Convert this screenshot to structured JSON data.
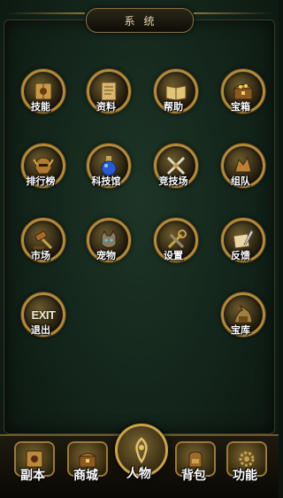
{
  "header": {
    "title": "系统"
  },
  "menu": [
    {
      "label": "技能",
      "icon": "spellbook-icon"
    },
    {
      "label": "资料",
      "icon": "scroll-icon"
    },
    {
      "label": "帮助",
      "icon": "open-book-icon"
    },
    {
      "label": "宝箱",
      "icon": "treasure-chest-icon"
    },
    {
      "label": "排行榜",
      "icon": "helmet-icon"
    },
    {
      "label": "科技馆",
      "icon": "potion-flask-icon"
    },
    {
      "label": "竞技场",
      "icon": "crossed-swords-icon"
    },
    {
      "label": "组队",
      "icon": "dragon-head-icon"
    },
    {
      "label": "市场",
      "icon": "gavel-icon"
    },
    {
      "label": "宠物",
      "icon": "beast-icon"
    },
    {
      "label": "设置",
      "icon": "tools-icon"
    },
    {
      "label": "反馈",
      "icon": "letter-quill-icon"
    },
    {
      "label": "退出",
      "icon": "exit-icon",
      "icon_text": "EXIT"
    },
    {
      "label": "宝库",
      "icon": "vault-dragon-icon"
    }
  ],
  "bottom_nav": [
    {
      "label": "副本",
      "icon": "dungeon-book-icon"
    },
    {
      "label": "商城",
      "icon": "shop-chest-icon"
    },
    {
      "label": "人物",
      "icon": "character-icon",
      "active": true
    },
    {
      "label": "背包",
      "icon": "backpack-icon"
    },
    {
      "label": "功能",
      "icon": "function-gear-icon"
    }
  ],
  "colors": {
    "gold": "#b08a3e",
    "background": "#13241a"
  }
}
